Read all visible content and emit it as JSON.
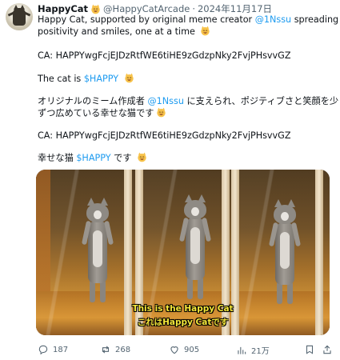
{
  "author": {
    "display_name": "HappyCat",
    "handle": "@HappyCatArcade",
    "separator": "·",
    "date": "2024年11月17日"
  },
  "text": {
    "line1_a": "Happy Cat, supported by original meme creator ",
    "line1_link": "@1Nssu",
    "line1_b": " spreading",
    "line2": "positivity and smiles, one at a time",
    "ca1": "CA: HAPPYwgFcjEJDzRtfWE6tiHE9zGdzpNky2FvjPHsvvGZ",
    "cat_is": "The cat is ",
    "ticker1": "$HAPPY",
    "jp1_a": "オリジナルのミーム作成者 ",
    "jp1_link": "@1Nssu",
    "jp1_b": " に支えられ、ポジティブさと笑顔を少し",
    "jp2": "ずつ広めている幸せな猫です",
    "ca2": "CA: HAPPYwgFcjEJDzRtfWE6tiHE9zGdzpNky2FvjPHsvvGZ",
    "jp3_a": "幸せな猫 ",
    "ticker2": "$HAPPY",
    "jp3_b": " です "
  },
  "media": {
    "subtitle_en": "This is the Happy Cat",
    "subtitle_jp": "これはHappy Catです"
  },
  "actions": {
    "replies": "187",
    "reposts": "268",
    "likes": "905",
    "views": "21万"
  },
  "colors": {
    "link": "#1d9bf0",
    "muted": "#536471",
    "text": "#0f1419",
    "subtitle": "#f5e83a"
  },
  "icons": [
    "smiling-cat-emoji",
    "reply-icon",
    "repost-icon",
    "like-icon",
    "views-icon",
    "bookmark-icon",
    "share-icon"
  ]
}
